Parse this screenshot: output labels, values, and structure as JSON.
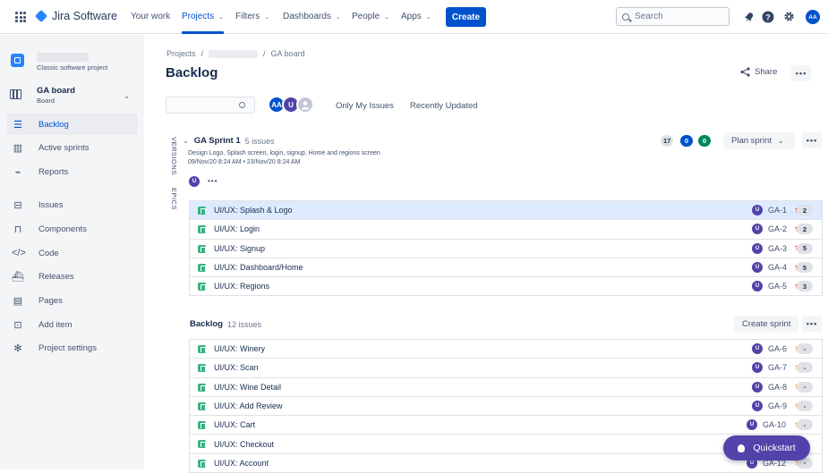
{
  "topbar": {
    "app_name": "Jira Software",
    "nav": [
      {
        "label": "Your work",
        "chevron": false
      },
      {
        "label": "Projects",
        "chevron": true
      },
      {
        "label": "Filters",
        "chevron": true
      },
      {
        "label": "Dashboards",
        "chevron": true
      },
      {
        "label": "People",
        "chevron": true
      },
      {
        "label": "Apps",
        "chevron": true
      }
    ],
    "create_label": "Create",
    "search_placeholder": "Search",
    "avatar_initials": "AA"
  },
  "sidebar": {
    "project_type": "Classic software project",
    "board_title": "GA board",
    "board_subtitle": "Board",
    "items": [
      {
        "label": "Backlog",
        "icon": "backlog-icon"
      },
      {
        "label": "Active sprints",
        "icon": "board-icon"
      },
      {
        "label": "Reports",
        "icon": "reports-icon"
      },
      {
        "label": "Issues",
        "icon": "issues-icon"
      },
      {
        "label": "Components",
        "icon": "components-icon"
      },
      {
        "label": "Code",
        "icon": "code-icon"
      },
      {
        "label": "Releases",
        "icon": "releases-icon"
      },
      {
        "label": "Pages",
        "icon": "pages-icon"
      },
      {
        "label": "Add item",
        "icon": "add-item-icon"
      },
      {
        "label": "Project settings",
        "icon": "settings-icon"
      }
    ]
  },
  "main": {
    "breadcrumb_root": "Projects",
    "breadcrumb_sep": "/",
    "breadcrumb_board": "GA board",
    "title": "Backlog",
    "share_label": "Share",
    "more_label": "•••",
    "filter": {
      "avatars": [
        "AA",
        "U"
      ],
      "only_my_issues": "Only My Issues",
      "recently_updated": "Recently Updated"
    },
    "side_tabs": [
      "VERSIONS",
      "EPICS"
    ],
    "sprint": {
      "name": "GA Sprint 1",
      "count": "5 issues",
      "description": "Design Logo, Splash screen, login, signup, Home and regions screen",
      "dates": "09/Nov/20 8:24 AM • 23/Nov/20 8:24 AM",
      "avatar": "U",
      "more": "•••",
      "counts": [
        "17",
        "0",
        "0"
      ],
      "plan_label": "Plan sprint",
      "issues": [
        {
          "title": "UI/UX: Splash & Logo",
          "key": "GA-1",
          "points": "2",
          "avatar": "U"
        },
        {
          "title": "UI/UX: Login",
          "key": "GA-2",
          "points": "2",
          "avatar": "U"
        },
        {
          "title": "UI/UX: Signup",
          "key": "GA-3",
          "points": "5",
          "avatar": "U"
        },
        {
          "title": "UI/UX: Dashboard/Home",
          "key": "GA-4",
          "points": "5",
          "avatar": "U"
        },
        {
          "title": "UI/UX: Regions",
          "key": "GA-5",
          "points": "3",
          "avatar": "U"
        }
      ]
    },
    "backlog": {
      "name": "Backlog",
      "count": "12 issues",
      "create_sprint_label": "Create sprint",
      "issues": [
        {
          "title": "UI/UX: Winery",
          "key": "GA-6",
          "points": "-",
          "avatar": "U"
        },
        {
          "title": "UI/UX: Scan",
          "key": "GA-7",
          "points": "-",
          "avatar": "U"
        },
        {
          "title": "UI/UX: Wine Detail",
          "key": "GA-8",
          "points": "-",
          "avatar": "U"
        },
        {
          "title": "UI/UX: Add Review",
          "key": "GA-9",
          "points": "-",
          "avatar": "U"
        },
        {
          "title": "UI/UX: Cart",
          "key": "GA-10",
          "points": "-",
          "avatar": "U"
        },
        {
          "title": "UI/UX: Checkout",
          "key": "",
          "points": "",
          "avatar": ""
        },
        {
          "title": "UI/UX: Account",
          "key": "GA-12",
          "points": "-",
          "avatar": "U"
        }
      ]
    },
    "quickstart_label": "Quickstart"
  },
  "colors": {
    "brand": "#0052cc",
    "story": "#36b37e",
    "priority_high": "#de350b",
    "priority_medium": "#ff8b00",
    "avatar_purple": "#5243aa",
    "done_green": "#00875a"
  }
}
